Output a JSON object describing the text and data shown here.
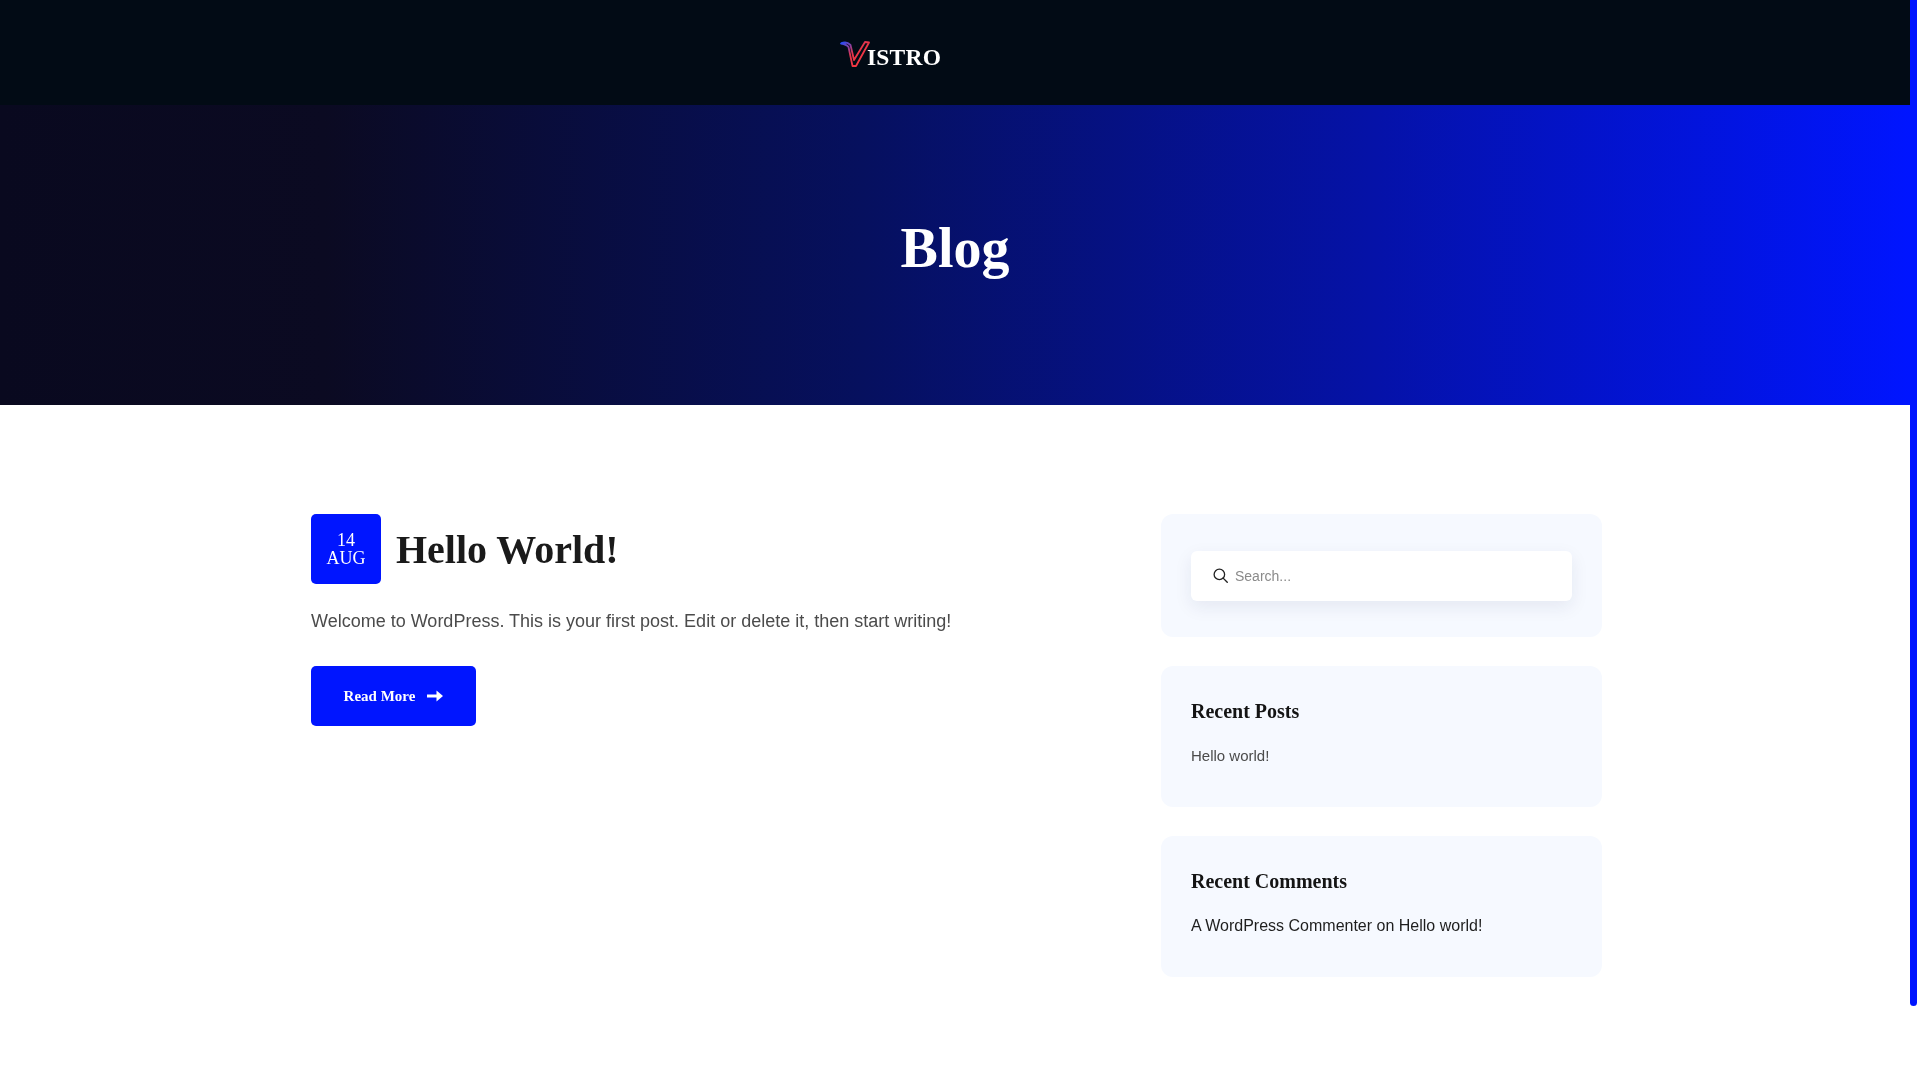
{
  "header": {
    "logo": {
      "text": "ISTRO"
    }
  },
  "hero": {
    "title": "Blog"
  },
  "posts": [
    {
      "date": {
        "day": "14",
        "month": "AUG"
      },
      "title": "Hello World!",
      "excerpt": "Welcome to WordPress. This is your first post. Edit or delete it, then start writing!",
      "read_more": "Read More"
    }
  ],
  "sidebar": {
    "search": {
      "placeholder": "Search..."
    },
    "widgets": [
      {
        "kind": "posts",
        "title": "Recent Posts",
        "items": [
          {
            "title": "Hello world!"
          }
        ]
      },
      {
        "kind": "comments",
        "title": "Recent Comments",
        "items": [
          {
            "author": "A WordPress Commenter",
            "connector": "on",
            "post": "Hello world!"
          }
        ]
      }
    ]
  }
}
